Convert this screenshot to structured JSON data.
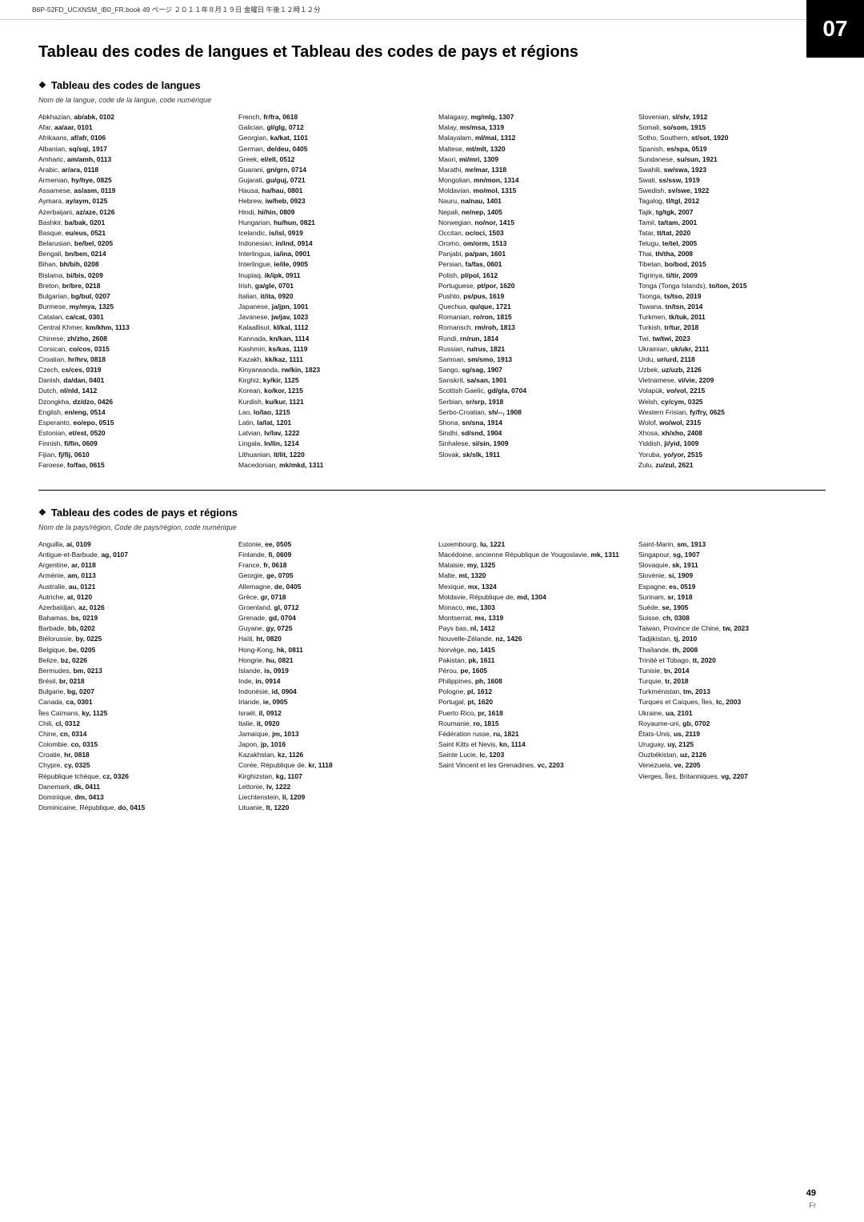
{
  "header": {
    "text": "B6P-52FD_UCXNSM_IB0_FR.book  49 ページ  ２０１１年８月１９日  金曜日  午後１２時１２分"
  },
  "chapter": "07",
  "page_title": "Tableau des codes de langues et Tableau des codes de pays\net régions",
  "lang_section": {
    "heading": "Tableau des codes de langues",
    "subheading": "Nom de la langue, code de la langue, code numérique",
    "entries_col1": [
      "Abkhazian, ab/abk, 0102",
      "Afar, aa/aar, 0101",
      "Afrikaans, af/afr, 0106",
      "Albanian, sq/sqi, 1917",
      "Amharic, am/amh, 0113",
      "Arabic, ar/ara, 0118",
      "Armenian, hy/hye, 0825",
      "Assamese, as/asm, 0119",
      "Aymara, ay/aym, 0125",
      "Azerbaijani, az/aze, 0126",
      "Bashkir, ba/bak, 0201",
      "Basque, eu/eus, 0521",
      "Belarusian, be/bel, 0205",
      "Bengali, bn/ben, 0214",
      "Bihan, bh/bih, 0208",
      "Bislama, bi/bis, 0209",
      "Breton, br/bre, 0218",
      "Bulgarian, bg/bul, 0207",
      "Burmese, my/mya, 1325",
      "Catalan, ca/cat, 0301",
      "Central Khmer, km/khm, 1113",
      "Chinese, zh/zho, 2608",
      "Corsican, co/cos, 0315",
      "Croatian, hr/hrv, 0818",
      "Czech, cs/ces, 0319",
      "Danish, da/dan, 0401",
      "Dutch, nl/nld, 1412",
      "Dzongkha, dz/dzo, 0426",
      "English, en/eng, 0514",
      "Esperanto, eo/epo, 0515",
      "Estonian, et/est, 0520",
      "Finnish, fi/fin, 0609",
      "Fijian, fj/fij, 0610",
      "Faroese, fo/fao, 0615"
    ],
    "entries_col2": [
      "French, fr/fra, 0618",
      "Galician, gl/glg, 0712",
      "Georgian, ka/kat, 1101",
      "German, de/deu, 0405",
      "Greek, el/ell, 0512",
      "Guarani, gn/grn, 0714",
      "Gujarati, gu/guj, 0721",
      "Hausa, ha/hau, 0801",
      "Hebrew, iw/heb, 0923",
      "Hindi, hi/hin, 0809",
      "Hungarian, hu/hun, 0821",
      "Icelandic, is/isl, 0919",
      "Indonesian, in/ind, 0914",
      "Interlingua, ia/ina, 0901",
      "Interlingue, ie/ile, 0905",
      "Inupiaq, ik/ipk, 0911",
      "Irish, ga/gle, 0701",
      "Italian, it/ita, 0920",
      "Japanese, ja/jpn, 1001",
      "Javanese, jw/jav, 1023",
      "Kalaallisut, kl/kal, 1112",
      "Kannada, kn/kan, 1114",
      "Kashmiri, ks/kas, 1119",
      "Kazakh, kk/kaz, 1111",
      "Kinyarwanda, rw/kin, 1823",
      "Kirghiz, ky/kir, 1125",
      "Korean, ko/kor, 1215",
      "Kurdish, ku/kur, 1121",
      "Lao, lo/lao, 1215",
      "Latin, la/lat, 1201",
      "Latvian, lv/lav, 1222",
      "Lingala, ln/lin, 1214",
      "Lithuanian, lt/lit, 1220",
      "Macedonian, mk/mkd, 1311"
    ],
    "entries_col3": [
      "Malagasy, mg/mlg, 1307",
      "Malay, ms/msa, 1319",
      "Malayalam, ml/mal, 1312",
      "Maltese, mt/mlt, 1320",
      "Maori, mi/mri, 1309",
      "Marathi, mr/mar, 1318",
      "Mongolian, mn/mon, 1314",
      "Moldavian, mo/mol, 1315",
      "Nauru, na/nau, 1401",
      "Nepali, ne/nep, 1405",
      "Norwegian, no/nor, 1415",
      "Occitan, oc/oci, 1503",
      "Oromo, om/orm, 1513",
      "Panjabi, pa/pan, 1601",
      "Persian, fa/fas, 0601",
      "Polish, pl/pol, 1612",
      "Portuguese, pt/por, 1620",
      "Pushto, ps/pus, 1619",
      "Quechua, qu/que, 1721",
      "Romanian, ro/ron, 1815",
      "Romansch, rm/roh, 1813",
      "Rundi, rn/run, 1814",
      "Russian, ru/rus, 1821",
      "Samoan, sm/smo, 1913",
      "Sango, sg/sag, 1907",
      "Sanskrit, sa/san, 1901",
      "Scottish Gaelic, gd/gla, 0704",
      "Serbian, sr/srp, 1918",
      "Serbo-Croatian, sh/--, 1908",
      "Shona, sn/sna, 1914",
      "Sindhi, sd/snd, 1904",
      "Sinhalese, si/sin, 1909",
      "Slovak, sk/slk, 1911"
    ],
    "entries_col4": [
      "Slovenian, sl/slv, 1912",
      "Somali, so/som, 1915",
      "Sotho, Southern, st/sot, 1920",
      "Spanish, es/spa, 0519",
      "Sundanese, su/sun, 1921",
      "Swahili, sw/swa, 1923",
      "Swati, ss/ssw, 1919",
      "Swedish, sv/swe, 1922",
      "Tagalog, tl/tgl, 2012",
      "Tajik, tg/tgk, 2007",
      "Tamil, ta/tam, 2001",
      "Tatar, tt/tat, 2020",
      "Telugu, te/tel, 2005",
      "Thai, th/tha, 2008",
      "Tibetan, bo/bod, 2015",
      "Tigrinya, ti/tir, 2009",
      "Tonga (Tonga Islands), to/ton, 2015",
      "Tsonga, ts/tso, 2019",
      "Tswana, tn/tsn, 2014",
      "Turkmen, tk/tuk, 2011",
      "Turkish, tr/tur, 2018",
      "Twi, tw/twi, 2023",
      "Ukrainian, uk/ukr, 2111",
      "Urdu, ur/urd, 2118",
      "Uzbek, uz/uzb, 2126",
      "Vietnamese, vi/vie, 2209",
      "Volapük, vo/vol, 2215",
      "Welsh, cy/cym, 0325",
      "Western Frisian, fy/fry, 0625",
      "Wolof, wo/wol, 2315",
      "Xhosa, xh/xho, 2408",
      "Yiddish, ji/yid, 1009",
      "Yoruba, yo/yor, 2515",
      "Zulu, zu/zul, 2621"
    ]
  },
  "country_section": {
    "heading": "Tableau des codes de pays et régions",
    "subheading": "Nom de la pays/région, Code de pays/région, code numérique",
    "entries_col1": [
      "Anguilla, ai, 0109",
      "Antigue-et-Barbude, ag, 0107",
      "Argentine, ar, 0118",
      "Arménie, am, 0113",
      "Australie, au, 0121",
      "Autriche, at, 0120",
      "Azerbaïdjan, az, 0126",
      "Bahamas, bs, 0219",
      "Barbade, bb, 0202",
      "Biélorussie, by, 0225",
      "Belgique, be, 0205",
      "Belize, bz, 0226",
      "Bermudes, bm, 0213",
      "Brésil, br, 0218",
      "Bulgarie, bg, 0207",
      "Canada, ca, 0301",
      "Îles Caïmans, ky, 1125",
      "Chili, cl, 0312",
      "Chine, cn, 0314",
      "Colombie, co, 0315",
      "Croatie, hr, 0818",
      "Chypre, cy, 0325",
      "République tchèque, cz, 0326",
      "Danemark, dk, 0411",
      "Dominique, dm, 0413",
      "Dominicaine, République, do, 0415"
    ],
    "entries_col2": [
      "Estonie, ee, 0505",
      "Finlande, fi, 0609",
      "France, fr, 0618",
      "Georgie, ge, 0705",
      "Allemagne, de, 0405",
      "Grèce, gr, 0718",
      "Groenland, gl, 0712",
      "Grenade, gd, 0704",
      "Guyane, gy, 0725",
      "Haïti, ht, 0820",
      "Hong-Kong, hk, 0811",
      "Hongrie, hu, 0821",
      "Islande, is, 0919",
      "Inde, in, 0914",
      "Indonésie, id, 0904",
      "Irlande, ie, 0905",
      "Israël, il, 0912",
      "Italie, it, 0920",
      "Jamaïque, jm, 1013",
      "Japon, jp, 1016",
      "Kazakhstan, kz, 1126",
      "Corée, République de, kr, 1118",
      "Kirghizstan, kg, 1107",
      "Lettonie, lv, 1222",
      "Liechtenstein, li, 1209",
      "Lituanie, lt, 1220"
    ],
    "entries_col3": [
      "Luxembourg, lu, 1221",
      "Macédoine, ancienne République de Yougoslavie, mk, 1311",
      "Malaisie, my, 1325",
      "Malte, mt, 1320",
      "Mexique, mx, 1324",
      "Moldavie, République de, md, 1304",
      "Monaco, mc, 1303",
      "Montserrat, ms, 1319",
      "Pays bas, nl, 1412",
      "Nouvelle-Zélande, nz, 1426",
      "Norvège, no, 1415",
      "Pakistan, pk, 1611",
      "Pérou, pe, 1605",
      "Philippines, ph, 1608",
      "Pologne, pl, 1612",
      "Portugal, pt, 1620",
      "Puerto Rico, pr, 1618",
      "Roumanie, ro, 1815",
      "Fédération russe, ru, 1821",
      "Saint Kitts et Nevis, kn, 1114",
      "Sainte Lucie, lc, 1203",
      "Saint Vincent et les Grenadines, vc, 2203"
    ],
    "entries_col4": [
      "Saint-Marin, sm, 1913",
      "Singapour, sg, 1907",
      "Slovaquie, sk, 1911",
      "Slovénie, si, 1909",
      "Espagne, es, 0519",
      "Surinam, sr, 1918",
      "Suède, se, 1905",
      "Suisse, ch, 0308",
      "Taiwan, Province de Chine, tw, 2023",
      "Tadjikistan, tj, 2010",
      "Thaïlande, th, 2008",
      "Trinité et Tobago, tt, 2020",
      "Tunisie, tn, 2014",
      "Turquie, tr, 2018",
      "Turkménistan, tm, 2013",
      "Turques et Caïques, Îles, tc, 2003",
      "Ukraine, ua, 2101",
      "Royaume-uni, gb, 0702",
      "États-Unis, us, 2119",
      "Uruguay, uy, 2125",
      "Ouzbékistan, uz, 2126",
      "Venezuela, ve, 2205",
      "Vierges, Îles, Britanniques, vg, 2207"
    ]
  },
  "page_number": "49",
  "footer_lang": "Fr"
}
